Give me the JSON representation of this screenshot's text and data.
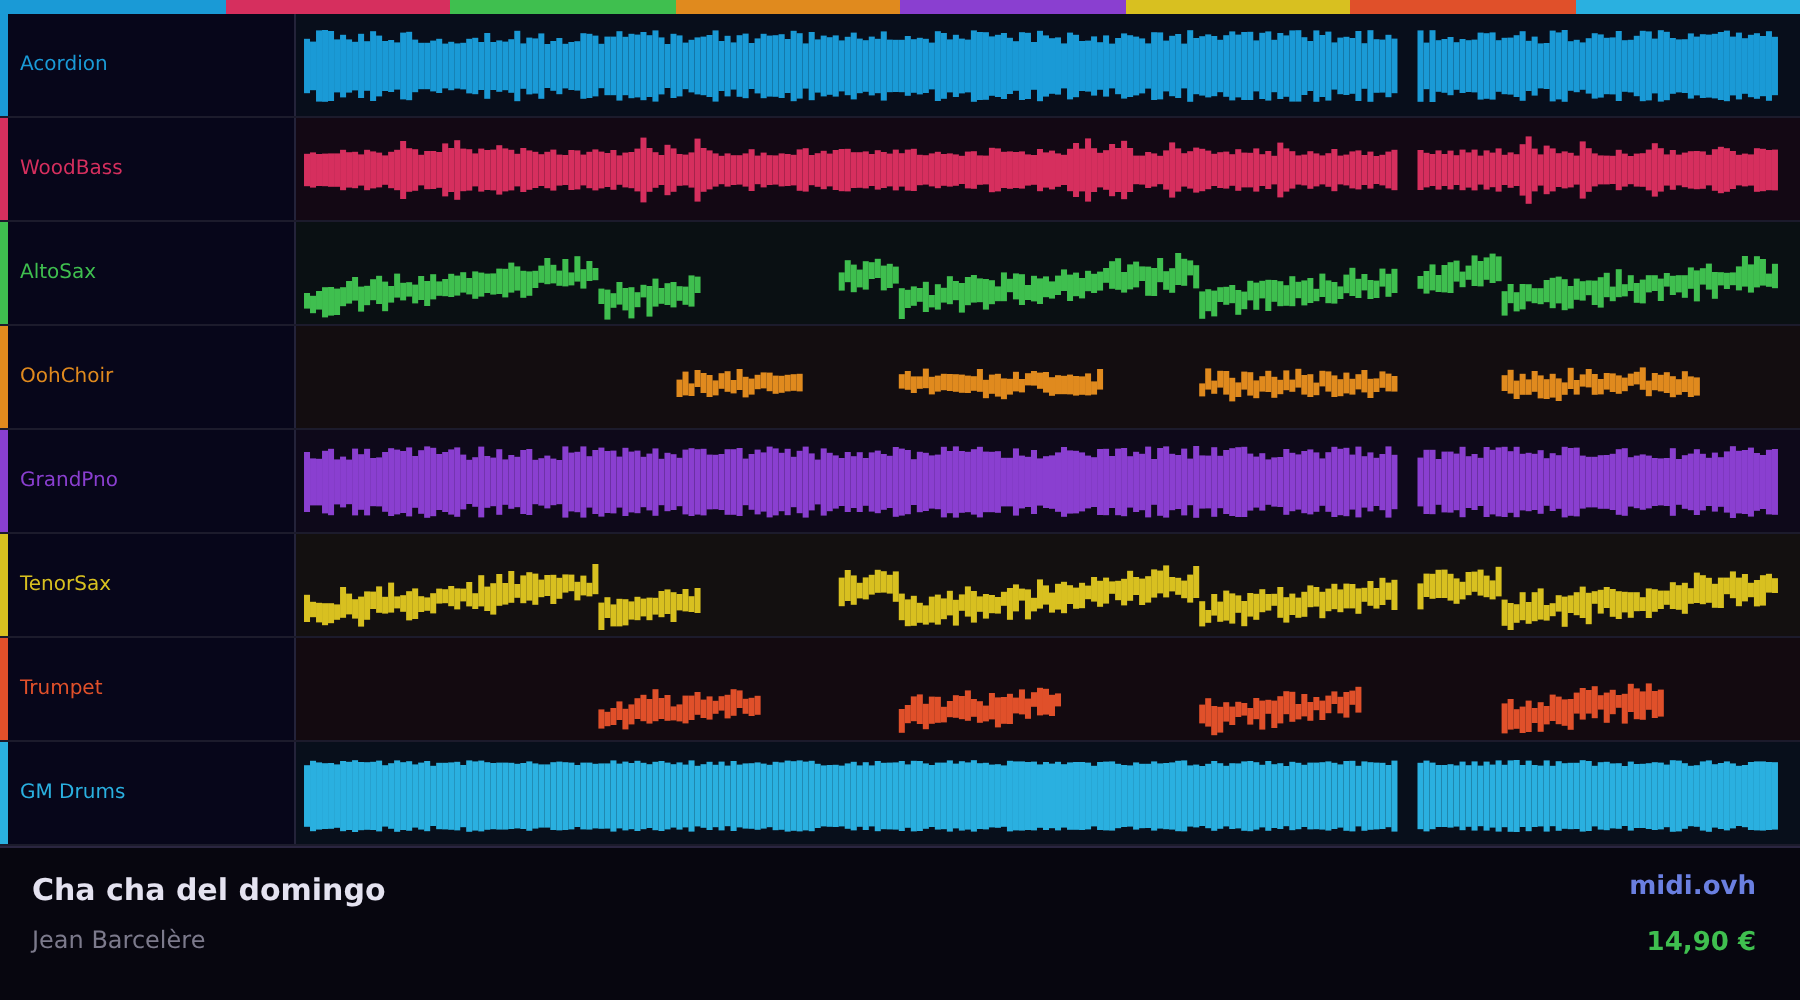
{
  "tracks": [
    {
      "name": "Acordion",
      "color": "#1a9ad6"
    },
    {
      "name": "WoodBass",
      "color": "#d62f5e"
    },
    {
      "name": "AltoSax",
      "color": "#3fbf4f"
    },
    {
      "name": "OohChoir",
      "color": "#e08a1e"
    },
    {
      "name": "GrandPno",
      "color": "#8a3fd0"
    },
    {
      "name": "TenorSax",
      "color": "#d8c020"
    },
    {
      "name": "Trumpet",
      "color": "#e0502a"
    },
    {
      "name": "GM Drums",
      "color": "#2ab0e0"
    }
  ],
  "song": {
    "title": "Cha cha del domingo",
    "artist": "Jean Barcelère"
  },
  "site": "midi.ovh",
  "price": "14,90 €"
}
